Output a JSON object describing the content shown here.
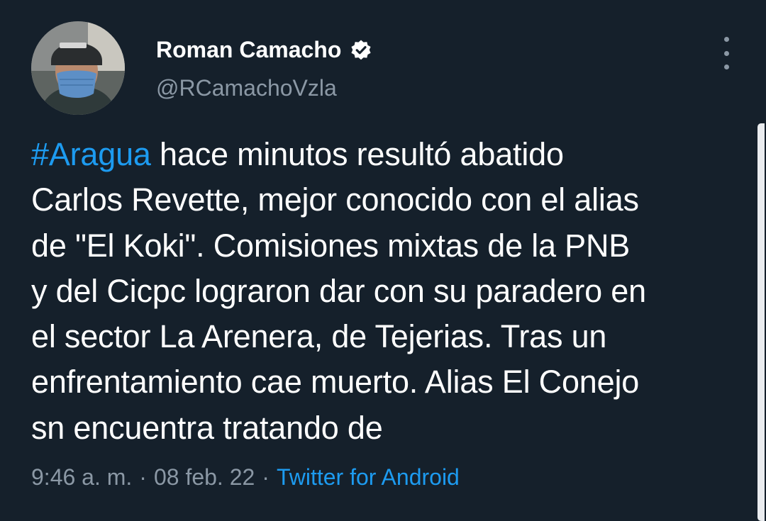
{
  "author": {
    "name": "Roman Camacho",
    "handle": "@RCamachoVzla",
    "verified_icon": "verified-badge-icon",
    "avatar_icon": "profile-photo-helmet-mask"
  },
  "menu": {
    "icon": "more-vertical-icon"
  },
  "tweet": {
    "hashtag": "#Aragua",
    "line1_rest": " hace minutos resultó abatido",
    "lines": [
      "Carlos Revette, mejor conocido con el alias",
      "de \"El Koki\". Comisiones mixtas de la PNB",
      "y del Cicpc lograron dar con su paradero en",
      "el sector La Arenera, de Tejerias. Tras un",
      "enfrentamiento cae muerto. Alias El Conejo",
      "sn encuentra tratando de"
    ]
  },
  "meta": {
    "time": "9:46 a. m.",
    "separator": "·",
    "date": "08 feb. 22",
    "source": "Twitter for Android"
  },
  "colors": {
    "background": "#15202b",
    "link": "#1d9bf0",
    "secondary_text": "#8b98a5",
    "primary_text": "#ffffff"
  }
}
